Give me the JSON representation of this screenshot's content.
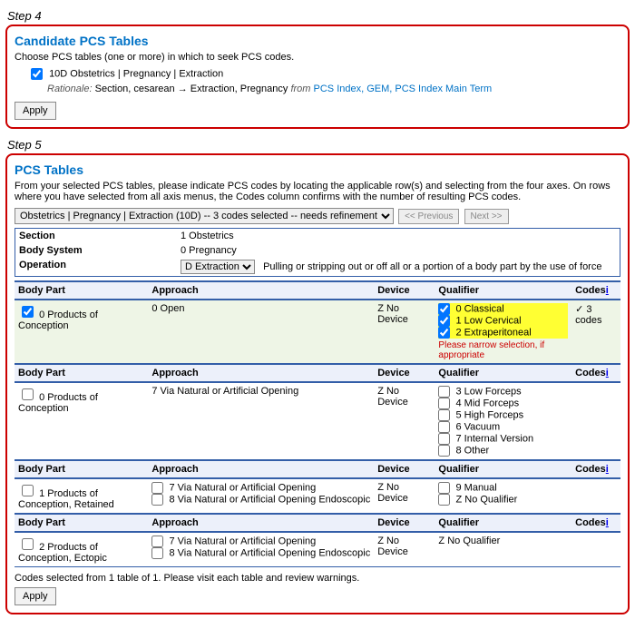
{
  "step4": {
    "label": "Step 4",
    "title": "Candidate PCS Tables",
    "instruction": "Choose PCS tables (one or more) in which to seek PCS codes.",
    "item": "10D Obstetrics | Pregnancy | Extraction",
    "rationale_label": "Rationale:",
    "rationale_text": " Section, cesarean → Extraction, Pregnancy ",
    "rationale_from": "from",
    "rationale_link": " PCS Index, GEM, PCS Index Main Term",
    "apply": "Apply"
  },
  "step5": {
    "label": "Step 5",
    "title": "PCS Tables",
    "instruction": "From your selected PCS tables, please indicate PCS codes by locating the applicable row(s) and selecting from the four axes. On rows where you have selected from all axis menus, the Codes column confirms with the number of resulting PCS codes.",
    "selector": "Obstetrics | Pregnancy | Extraction (10D) -- 3 codes selected -- needs refinement",
    "prev": "<< Previous",
    "next": "Next >>",
    "axes": {
      "section_label": "Section",
      "section_value": "1 Obstetrics",
      "bodysys_label": "Body System",
      "bodysys_value": "0 Pregnancy",
      "operation_label": "Operation",
      "operation_select": "D Extraction",
      "operation_desc": "Pulling or stripping out or off all or a portion of a body part by the use of force"
    },
    "headers": {
      "bodypart": "Body Part",
      "approach": "Approach",
      "device": "Device",
      "qualifier": "Qualifier",
      "codes": "Codes"
    },
    "info": "i",
    "r1": {
      "bodypart": "0 Products of Conception",
      "approach": "0 Open",
      "device": "Z No Device",
      "q0": "0 Classical",
      "q1": "1 Low Cervical",
      "q2": "2 Extraperitoneal",
      "warn": "Please narrow selection, if appropriate",
      "codes": "3 codes"
    },
    "r2": {
      "bodypart": "0 Products of Conception",
      "approach": "7 Via Natural or Artificial Opening",
      "device": "Z No Device",
      "q3": "3 Low Forceps",
      "q4": "4 Mid Forceps",
      "q5": "5 High Forceps",
      "q6": "6 Vacuum",
      "q7": "7 Internal Version",
      "q8": "8 Other"
    },
    "r3": {
      "bodypart": "1 Products of Conception, Retained",
      "appr7": "7 Via Natural or Artificial Opening",
      "appr8": "8 Via Natural or Artificial Opening Endoscopic",
      "device": "Z No Device",
      "q9": "9 Manual",
      "qz": "Z No Qualifier"
    },
    "r4": {
      "bodypart": "2 Products of Conception, Ectopic",
      "appr7": "7 Via Natural or Artificial Opening",
      "appr8": "8 Via Natural or Artificial Opening Endoscopic",
      "device": "Z No Device",
      "qz": "Z No Qualifier"
    },
    "footnote": "Codes selected from 1 table of 1. Please visit each table and review warnings.",
    "apply": "Apply"
  }
}
